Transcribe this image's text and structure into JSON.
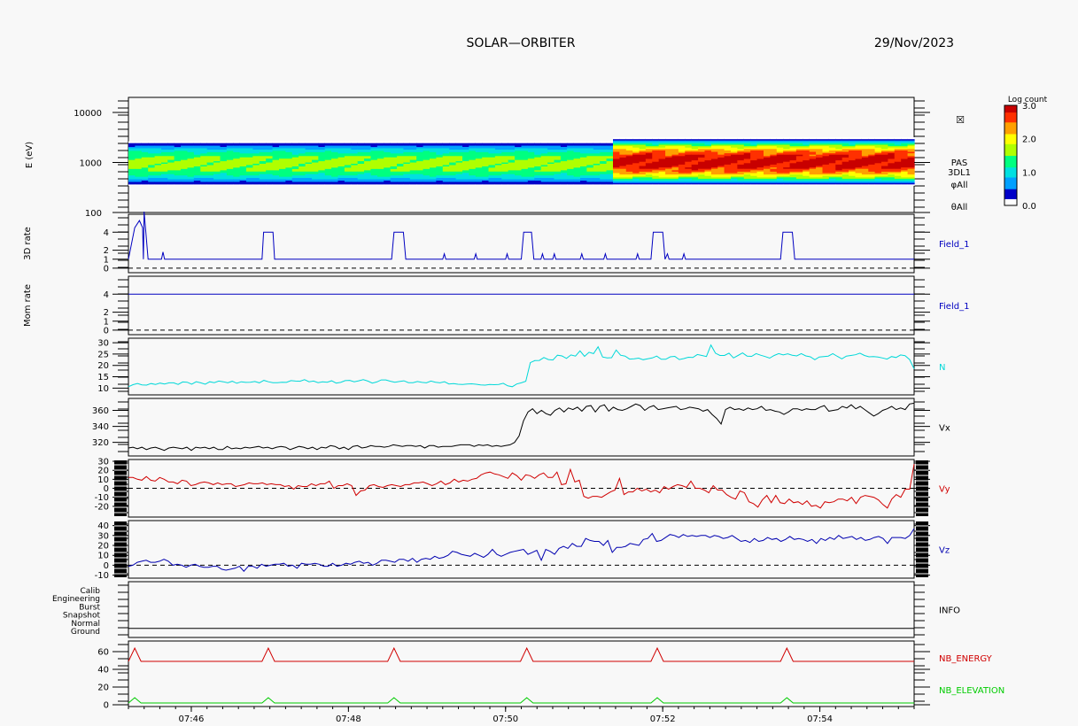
{
  "header": {
    "title": "SOLAR—ORBITER",
    "date": "29/Nov/2023"
  },
  "colorbar": {
    "title": "Log count",
    "ticks": [
      "3.0",
      "2.0",
      "1.0",
      "0.0"
    ],
    "colors": [
      "#ffffff",
      "#0000c8",
      "#00a0ff",
      "#00e0e0",
      "#00ff80",
      "#b0ff00",
      "#ffff00",
      "#ffa000",
      "#ff3000",
      "#c80000"
    ]
  },
  "time_axis": {
    "labels": [
      "07:46",
      "07:48",
      "07:50",
      "07:52",
      "07:54"
    ],
    "start": "07:45:00",
    "end": "07:55:00"
  },
  "spectrogram_labels": {
    "ylabel": "E (eV)",
    "yticks": [
      "10000",
      "1000",
      "100"
    ],
    "right_labels": [
      "PAS",
      "3DL1",
      "φAll",
      "θAll"
    ]
  },
  "info_panel": {
    "rows": [
      "Calib",
      "Engineering",
      "Burst",
      "Snapshot",
      "Normal",
      "Ground"
    ],
    "right_label": "INFO"
  },
  "chart_data": [
    {
      "id": "spectrogram",
      "type": "heatmap",
      "ylabel": "E (eV)",
      "yscale": "log",
      "ylim": [
        100,
        20000
      ],
      "zlabel": "Log count",
      "zlim": [
        0.0,
        3.0
      ],
      "segments": [
        {
          "from_min": 0.0,
          "to_min": 6.1,
          "band_eV": [
            350,
            2500
          ],
          "peak_logcount": 1.6
        },
        {
          "from_min": 6.1,
          "to_min": 10.0,
          "band_eV": [
            350,
            3000
          ],
          "peak_logcount": 2.9
        }
      ]
    },
    {
      "id": "rate3d",
      "type": "line",
      "ylabel": "3D rate",
      "ylim": [
        -0.5,
        6.0
      ],
      "yticks": [
        0,
        1,
        2,
        4
      ],
      "dashed_zero": true,
      "right_labels": [
        "Field_1"
      ],
      "series": [
        {
          "name": "Field_1",
          "color": "#0000c0",
          "x": [
            0,
            0.08,
            0.14,
            0.18,
            0.19,
            0.2,
            0.25,
            0.42,
            0.44,
            0.46,
            0.81,
            1.7,
            1.72,
            1.74,
            1.8,
            1.84,
            1.86,
            1.88,
            3.35,
            3.38,
            3.42,
            3.5,
            3.53,
            4.0,
            4.02,
            4.04,
            4.4,
            4.42,
            4.44,
            4.8,
            4.82,
            4.84,
            5.0,
            5.03,
            5.07,
            5.13,
            5.16,
            5.25,
            5.27,
            5.29,
            5.4,
            5.42,
            5.44,
            5.75,
            5.77,
            5.79,
            6.05,
            6.07,
            6.09,
            6.46,
            6.48,
            6.5,
            6.65,
            6.68,
            6.72,
            6.8,
            6.83,
            6.86,
            6.88,
            6.9,
            7.05,
            7.07,
            7.09,
            8.3,
            8.33,
            8.37,
            8.45,
            8.48,
            10.0
          ],
          "y": [
            1,
            4.5,
            5.3,
            4.5,
            1,
            6.3,
            1,
            1,
            1.8,
            1,
            1,
            1,
            4,
            4,
            4,
            4,
            1,
            1,
            1,
            4,
            4,
            4,
            1,
            1,
            1.6,
            1,
            1,
            1.6,
            1,
            1,
            1.6,
            1,
            1,
            4,
            4,
            4,
            1,
            1,
            1.6,
            1,
            1,
            1.6,
            1,
            1,
            1.6,
            1,
            1,
            1.6,
            1,
            1,
            1.6,
            1,
            1,
            4,
            4,
            4,
            1,
            1.6,
            1,
            1,
            1,
            1.6,
            1,
            1,
            4,
            4,
            4,
            1,
            1
          ]
        }
      ]
    },
    {
      "id": "mom_rate",
      "type": "line",
      "ylabel": "Mom rate",
      "ylim": [
        -0.5,
        6.0
      ],
      "yticks": [
        0,
        1,
        2,
        4
      ],
      "dashed_zero": true,
      "right_labels": [
        "Field_1"
      ],
      "series": [
        {
          "name": "Field_1",
          "color": "#0000c0",
          "x": [
            0,
            10
          ],
          "y": [
            4,
            4
          ]
        }
      ]
    },
    {
      "id": "density",
      "type": "line",
      "ylim": [
        7,
        32
      ],
      "yticks": [
        10,
        15,
        20,
        25,
        30
      ],
      "right_labels": [
        "N"
      ],
      "series": [
        {
          "name": "N",
          "color": "#00d8d8",
          "dt_min": 0.1,
          "y": [
            10.6,
            11.5,
            12.0,
            11.4,
            11.3,
            12.0,
            11.6,
            12.2,
            11.8,
            12.3,
            12.3,
            11.6,
            12.7,
            12.6,
            11.7,
            12.8,
            12.3,
            11.7,
            12.8,
            12.4,
            13.1,
            12.8,
            12.3,
            13.0,
            12.1,
            12.8,
            12.5,
            12.6,
            12.9,
            12.3,
            13.4,
            12.8,
            12.4,
            12.4,
            12.6,
            12.5,
            13.3,
            13.1,
            13.0,
            13.7,
            12.8,
            13.1,
            12.4,
            12.8,
            12.6,
            13.2,
            12.2,
            12.5,
            13.3,
            13.4,
            12.8,
            13.2,
            13.7,
            13.1,
            12.2,
            12.7,
            13.6,
            13.6,
            13.0,
            12.6,
            12.9,
            13.2,
            12.4,
            12.4,
            12.9,
            12.5,
            12.3,
            13.1,
            12.6,
            12.3,
            12.8,
            11.8,
            12.0,
            11.7,
            11.6,
            11.8,
            11.9,
            11.7,
            11.4,
            11.3,
            11.6,
            11.5,
            11.6,
            12.1,
            11.0,
            10.6,
            11.8,
            12.3,
            13.0,
            21.2,
            22.1,
            22.2,
            23.5,
            22.6,
            22.4,
            24.5,
            24.2,
            23.1,
            24.6,
            24.1,
            26.4,
            24.0,
            25.8,
            25.2,
            28.2,
            23.7,
            23.3,
            23.4,
            26.8,
            24.5,
            24.1,
            22.8,
            22.9,
            23.2,
            22.5,
            22.9,
            23.3,
            24.1,
            22.7,
            22.7,
            23.8,
            24.0,
            22.6,
            23.0,
            23.6,
            23.5,
            24.8,
            24.4,
            23.9,
            29.0,
            25.4,
            24.4,
            24.4,
            25.4,
            23.3,
            24.4,
            25.5,
            24.1,
            24.0,
            25.2,
            24.5,
            23.9,
            23.2,
            24.4,
            25.2,
            24.6,
            25.1,
            24.5,
            24.2,
            25.2,
            24.2,
            23.8,
            22.5,
            23.7,
            23.9,
            24.1,
            25.2,
            24.0,
            22.9,
            24.1,
            24.4,
            24.7,
            25.4,
            24.4,
            23.8,
            23.9,
            23.7,
            23.3,
            22.8,
            23.9,
            23.5,
            24.6,
            24.3,
            22.6,
            18.5
          ]
        }
      ]
    },
    {
      "id": "vx",
      "type": "line",
      "ylim": [
        303,
        375
      ],
      "yticks": [
        320,
        340,
        360
      ],
      "right_labels": [
        "Vx"
      ],
      "series": [
        {
          "name": "Vx",
          "color": "#000000",
          "dt_min": 0.1,
          "y": [
            313,
            314,
            312,
            314,
            311,
            313,
            314,
            312,
            310,
            313,
            314,
            313,
            312,
            314,
            310,
            314,
            313,
            314,
            312,
            314,
            311,
            311,
            315,
            312,
            313,
            312,
            314,
            313,
            314,
            315,
            313,
            314,
            312,
            314,
            315,
            314,
            311,
            313,
            315,
            314,
            312,
            314,
            311,
            314,
            313,
            316,
            315,
            312,
            314,
            311,
            315,
            316,
            313,
            314,
            316,
            315,
            315,
            314,
            315,
            317,
            316,
            315,
            316,
            316,
            315,
            316,
            313,
            316,
            316,
            314,
            315,
            315,
            315,
            316,
            317,
            317,
            317,
            315,
            317,
            316,
            317,
            315,
            316,
            315,
            316,
            317,
            320,
            328,
            347,
            358,
            362,
            356,
            360,
            356,
            354,
            360,
            363,
            358,
            363,
            361,
            364,
            359,
            365,
            366,
            358,
            365,
            367,
            359,
            364,
            361,
            360,
            362,
            365,
            368,
            366,
            360,
            364,
            366,
            361,
            362,
            363,
            364,
            365,
            361,
            362,
            364,
            363,
            362,
            359,
            361,
            355,
            350,
            343,
            361,
            364,
            361,
            362,
            360,
            363,
            361,
            362,
            365,
            360,
            361,
            359,
            358,
            355,
            358,
            362,
            362,
            360,
            362,
            361,
            361,
            364,
            366,
            359,
            360,
            361,
            365,
            363,
            367,
            362,
            365,
            361,
            357,
            353,
            356,
            360,
            362,
            365,
            361,
            363,
            361,
            368,
            369
          ]
        }
      ]
    },
    {
      "id": "vy",
      "type": "line",
      "ylim": [
        -32,
        32
      ],
      "yticks": [
        -20,
        -10,
        0,
        10,
        20,
        30
      ],
      "dashed_zero": true,
      "right_labels": [
        "Vy"
      ],
      "series": [
        {
          "name": "Vy",
          "color": "#d00000",
          "dt_min": 0.1,
          "y": [
            12,
            12,
            10,
            9,
            13,
            9,
            8,
            12,
            10,
            7,
            7,
            5,
            9,
            8,
            3,
            4,
            6,
            7,
            6,
            4,
            6,
            4,
            5,
            5,
            2,
            3,
            4,
            6,
            5,
            5,
            6,
            4,
            5,
            4,
            4,
            2,
            3,
            -1,
            3,
            2,
            2,
            5,
            3,
            5,
            5,
            8,
            0,
            3,
            3,
            5,
            3,
            -8,
            -3,
            -2,
            3,
            4,
            2,
            1,
            3,
            4,
            3,
            2,
            4,
            4,
            6,
            6,
            7,
            5,
            3,
            5,
            8,
            4,
            6,
            10,
            7,
            9,
            8,
            10,
            11,
            15,
            17,
            18,
            16,
            15,
            13,
            11,
            17,
            14,
            9,
            15,
            14,
            11,
            15,
            17,
            12,
            12,
            18,
            4,
            5,
            21,
            7,
            9,
            -9,
            -11,
            -9,
            -9,
            -10,
            -7,
            -4,
            -2,
            11,
            -7,
            -4,
            -4,
            0,
            -3,
            -1,
            -4,
            -2,
            -5,
            2,
            -1,
            2,
            4,
            3,
            1,
            8,
            0,
            0,
            -2,
            -5,
            3,
            -2,
            -2,
            -7,
            -10,
            -12,
            -3,
            -5,
            -15,
            -17,
            -21,
            -13,
            -8,
            -16,
            -8,
            -16,
            -17,
            -12,
            -16,
            -15,
            -18,
            -14,
            -20,
            -19,
            -22,
            -15,
            -16,
            -15,
            -12,
            -12,
            -14,
            -10,
            -17,
            -10,
            -8,
            -9,
            -10,
            -13,
            -18,
            -22,
            -12,
            -7,
            -10,
            -1,
            -1,
            27
          ]
        }
      ]
    },
    {
      "id": "vz",
      "type": "line",
      "ylim": [
        -13,
        45
      ],
      "yticks": [
        -10,
        0,
        10,
        20,
        30,
        40
      ],
      "dashed_zero": true,
      "right_labels": [
        "Vz"
      ],
      "series": [
        {
          "name": "Vz",
          "color": "#0000b0",
          "dt_min": 0.1,
          "y": [
            -1,
            0,
            3,
            4,
            5,
            3,
            3,
            4,
            6,
            4,
            0,
            1,
            0,
            -2,
            0,
            1,
            -1,
            -2,
            -2,
            -1,
            -1,
            -4,
            -5,
            -4,
            -3,
            -1,
            -6,
            -1,
            -1,
            -3,
            1,
            -1,
            0,
            1,
            1,
            2,
            -1,
            0,
            -3,
            2,
            1,
            1,
            2,
            1,
            -1,
            -1,
            2,
            -1,
            0,
            2,
            1,
            3,
            4,
            2,
            3,
            0,
            2,
            5,
            5,
            4,
            3,
            6,
            6,
            4,
            7,
            3,
            6,
            7,
            6,
            9,
            7,
            8,
            10,
            14,
            13,
            11,
            10,
            9,
            12,
            10,
            8,
            11,
            16,
            11,
            9,
            11,
            13,
            14,
            15,
            16,
            11,
            13,
            15,
            5,
            16,
            14,
            11,
            17,
            19,
            17,
            22,
            19,
            19,
            27,
            25,
            24,
            24,
            20,
            25,
            13,
            18,
            18,
            19,
            22,
            21,
            20,
            26,
            27,
            32,
            24,
            25,
            28,
            31,
            30,
            28,
            31,
            29,
            30,
            29,
            30,
            30,
            28,
            30,
            29,
            27,
            28,
            30,
            27,
            24,
            25,
            23,
            27,
            24,
            25,
            28,
            26,
            27,
            24,
            26,
            29,
            26,
            27,
            26,
            24,
            26,
            22,
            27,
            25,
            28,
            26,
            30,
            27,
            28,
            29,
            26,
            28,
            25,
            26,
            28,
            29,
            27,
            22,
            28,
            28,
            28,
            27,
            30,
            37
          ]
        }
      ]
    },
    {
      "id": "info",
      "type": "table",
      "rows": [
        "Calib",
        "Engineering",
        "Burst",
        "Snapshot",
        "Normal",
        "Ground"
      ],
      "active_row": "Normal"
    },
    {
      "id": "nb",
      "type": "line",
      "ylim": [
        -2,
        72
      ],
      "yticks": [
        0,
        20,
        40,
        60
      ],
      "right_labels": [
        "NB_ENERGY",
        "NB_ELEVATION"
      ],
      "series": [
        {
          "name": "NB_ENERGY",
          "color": "#d00000",
          "x": [
            0,
            0.08,
            0.18,
            8.0,
            10.0
          ],
          "y": [
            49,
            64,
            49,
            49,
            49
          ],
          "spike_times_min": [
            0.08,
            1.78,
            3.38,
            5.07,
            6.73,
            8.38
          ],
          "base": 49,
          "peak": 64
        },
        {
          "name": "NB_ELEVATION",
          "color": "#00cc00",
          "spike_times_min": [
            0.08,
            1.78,
            3.38,
            5.07,
            6.73,
            8.38
          ],
          "base": 2,
          "peak": 8
        }
      ]
    }
  ]
}
